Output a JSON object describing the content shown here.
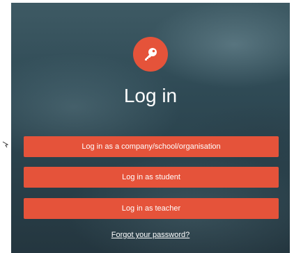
{
  "login": {
    "logo_icon": "key-icon",
    "title": "Log in",
    "buttons": {
      "company": "Log in as a company/school/organisation",
      "student": "Log in as student",
      "teacher": "Log in as teacher"
    },
    "forgot_link": "Forgot your password?"
  },
  "colors": {
    "accent": "#e5533a",
    "text": "#ffffff",
    "background": "#2f4a55"
  }
}
